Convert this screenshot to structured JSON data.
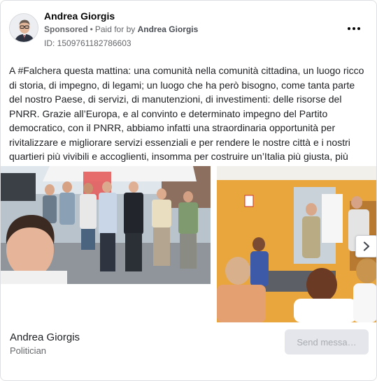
{
  "ad": {
    "page_name": "Andrea Giorgis",
    "sponsored_label": "Sponsored",
    "paid_for_prefix": "Paid for by",
    "paid_for_by": "Andrea Giorgis",
    "ad_id": "ID: 1509761182786603",
    "more_icon": "more-horizontal-icon"
  },
  "body": {
    "text": "A #Falchera questa mattina: una comunità nella comunità cittadina, un luogo ricco di storia, di impegno, di legami; un luogo che ha però bisogno, come tanta parte del nostro Paese, di servizi, di manutenzioni, di investimenti: delle risorse del PNRR. Grazie all’Europa, e al convinto e determinato impegno del Partito democratico, con il PNRR, abbiamo infatti una straordinaria opportunità per rivitalizzare e migliorare servizi essenziali e per rendere le nostre città e i nostri quartieri più vivibili e accoglienti, insomma per costruire un’Italia più giusta, più moderna, più…"
  },
  "carousel": {
    "next_icon": "chevron-right-icon"
  },
  "footer": {
    "name": "Andrea Giorgis",
    "category": "Politician",
    "send_label": "Send messa…"
  },
  "colors": {
    "button_bg": "#e4e6eb",
    "button_text": "#a9acb1",
    "secondary_text": "#65676b"
  }
}
